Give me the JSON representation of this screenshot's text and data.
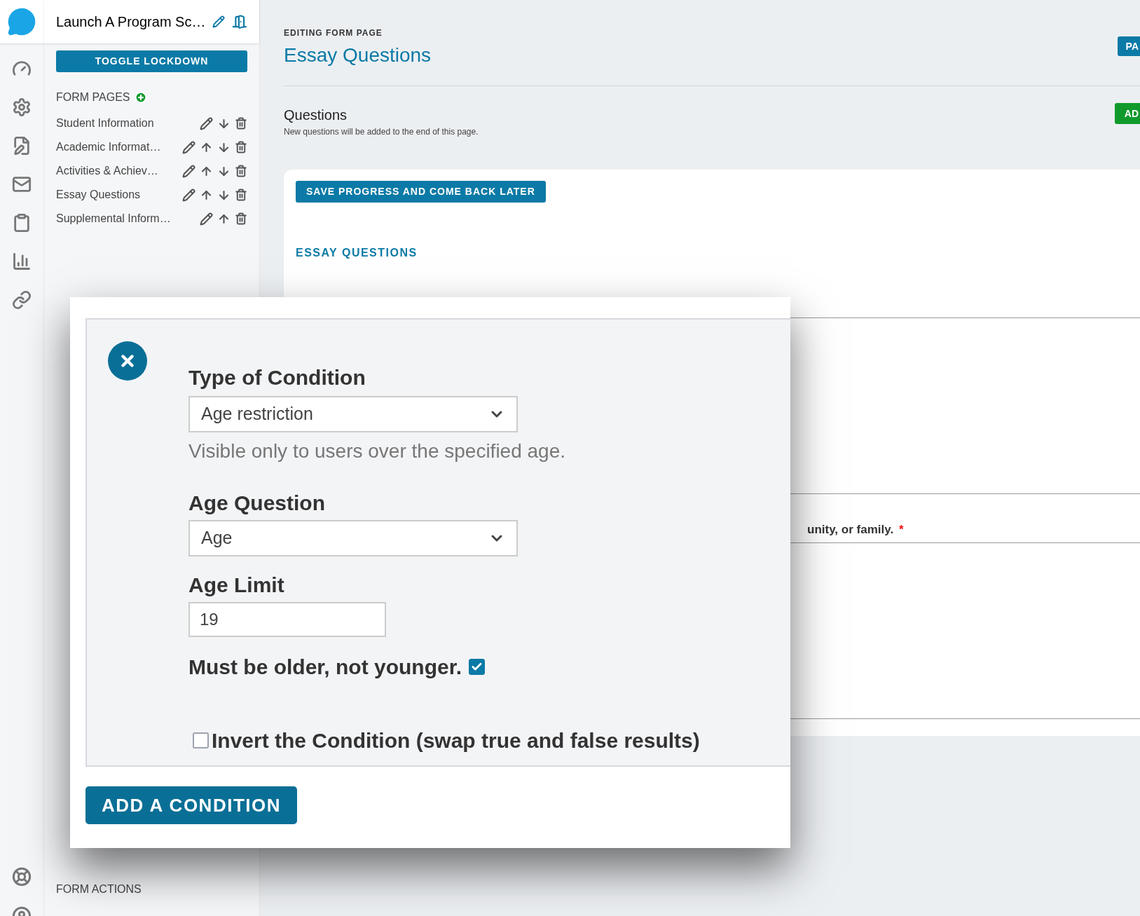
{
  "app_title": "Launch A Program Sc…",
  "sidebar": {
    "toggle_button": "TOGGLE LOCKDOWN",
    "section_title": "FORM PAGES",
    "pages": [
      {
        "label": "Student Information",
        "can_move_up": false,
        "can_move_down": true
      },
      {
        "label": "Academic Informat…",
        "can_move_up": true,
        "can_move_down": true
      },
      {
        "label": "Activities & Achiev…",
        "can_move_up": true,
        "can_move_down": true
      },
      {
        "label": "Essay Questions",
        "can_move_up": true,
        "can_move_down": true
      },
      {
        "label": "Supplemental Inform…",
        "can_move_up": true,
        "can_move_down": false
      }
    ],
    "footer_title": "FORM ACTIONS"
  },
  "main": {
    "eyebrow": "EDITING FORM PAGE",
    "title": "Essay Questions",
    "page_button": "PA",
    "questions_title": "Questions",
    "questions_hint": "New questions will be added to the end of this page.",
    "add_button": "AD",
    "save_button": "SAVE PROGRESS AND COME BACK LATER",
    "section_heading": "ESSAY QUESTIONS",
    "question_fragment": "unity, or family.",
    "required_mark": "*"
  },
  "condition_dialog": {
    "type_label": "Type of Condition",
    "type_value": "Age restriction",
    "type_hint": "Visible only to users over the specified age.",
    "age_question_label": "Age Question",
    "age_question_value": "Age",
    "age_limit_label": "Age Limit",
    "age_limit_value": "19",
    "older_label": "Must be older, not younger.",
    "older_checked": true,
    "invert_label": "Invert the Condition (swap true and false results)",
    "invert_checked": false,
    "add_button": "ADD A CONDITION"
  }
}
